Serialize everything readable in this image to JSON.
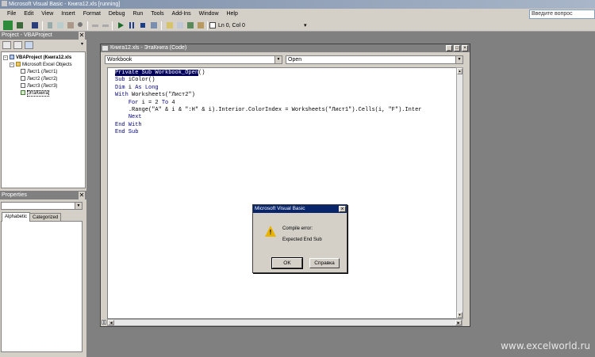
{
  "window": {
    "title": "Microsoft Visual Basic - Книга12.xls [running]"
  },
  "menu": [
    "File",
    "Edit",
    "View",
    "Insert",
    "Format",
    "Debug",
    "Run",
    "Tools",
    "Add-Ins",
    "Window",
    "Help"
  ],
  "help_search": {
    "placeholder": "Введите вопрос"
  },
  "toolbar": {
    "position": "Ln 0, Col 0"
  },
  "project_panel": {
    "title": "Project - VBAProject",
    "tree": [
      {
        "label": "VBAProject (Книга12.xls",
        "level": 0,
        "icon": "vbproject-icon"
      },
      {
        "label": "Microsoft Excel Objects",
        "level": 1,
        "icon": "folder-icon"
      },
      {
        "label": "Лист1 (Лист1)",
        "level": 2,
        "icon": "sheet-icon"
      },
      {
        "label": "Лист2 (Лист2)",
        "level": 2,
        "icon": "sheet-icon"
      },
      {
        "label": "Лист3 (Лист3)",
        "level": 2,
        "icon": "sheet-icon"
      },
      {
        "label": "ЭтаКнига",
        "level": 2,
        "icon": "workbook-icon"
      }
    ]
  },
  "properties_panel": {
    "title": "Properties",
    "tabs": [
      "Alphabetic",
      "Categorized"
    ]
  },
  "code_window": {
    "title": "Книга12.xls - ЭтаКнига (Code)",
    "object_combo": "Workbook",
    "procedure_combo": "Open",
    "lines": [
      {
        "kw": "Private Sub Workbook_Open",
        "rest": "()",
        "highlight": true
      },
      {
        "kw": "Sub",
        "rest": " iColor()"
      },
      {
        "kw": "Dim",
        "rest": " i ",
        "kw2": "As Long"
      },
      {
        "kw": "With",
        "rest": " Worksheets(\"Лист2\")"
      },
      {
        "indent": "    ",
        "kw": "For",
        "rest": " i = 2 ",
        "kw2": "To",
        "rest2": " 4"
      },
      {
        "indent": "    ",
        "rest": ".Range(\"A\" & i & \":H\" & i).Interior.ColorIndex = Worksheets(\"Лист1\").Cells(i, \"F\").Inter"
      },
      {
        "indent": "    ",
        "kw": "Next"
      },
      {
        "kw": "End With"
      },
      {
        "kw": "End Sub"
      }
    ]
  },
  "dialog": {
    "title": "Microsoft Visual Basic",
    "line1": "Compile error:",
    "line2": "Expected End Sub",
    "ok": "OK",
    "help": "Справка"
  },
  "watermark": "www.excelworld.ru"
}
